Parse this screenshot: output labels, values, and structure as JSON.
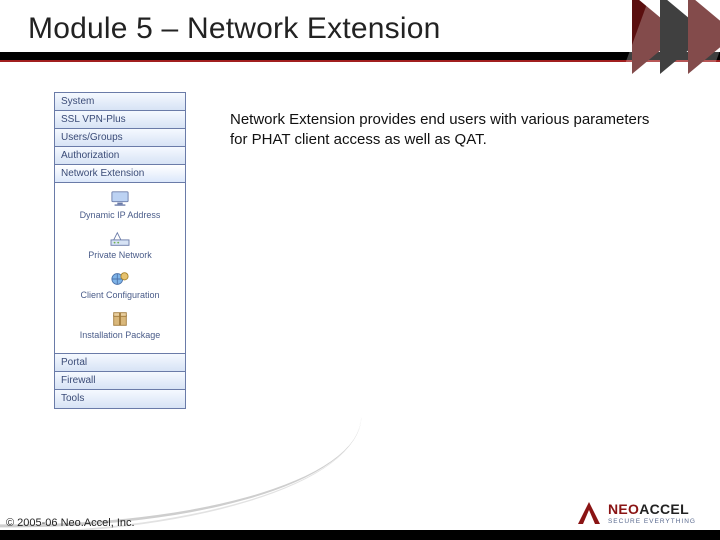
{
  "title": "Module 5 – Network Extension",
  "body_text": "Network Extension provides end users with various parameters for PHAT client access as well as QAT.",
  "sidebar": {
    "tabs_top": [
      "System",
      "SSL VPN-Plus",
      "Users/Groups",
      "Authorization",
      "Network Extension"
    ],
    "selected_tab": "Network Extension",
    "items": [
      {
        "label": "Dynamic IP Address",
        "icon": "monitor-icon"
      },
      {
        "label": "Private Network",
        "icon": "network-icon"
      },
      {
        "label": "Client Configuration",
        "icon": "gear-globe-icon"
      },
      {
        "label": "Installation Package",
        "icon": "package-icon"
      }
    ],
    "tabs_bottom": [
      "Portal",
      "Firewall",
      "Tools"
    ]
  },
  "footer": {
    "copyright": "© 2005-06 Neo.Accel, Inc.",
    "logo_main": "NEO",
    "logo_sub": "ACCEL",
    "logo_tag": "SECURE EVERYTHING"
  }
}
